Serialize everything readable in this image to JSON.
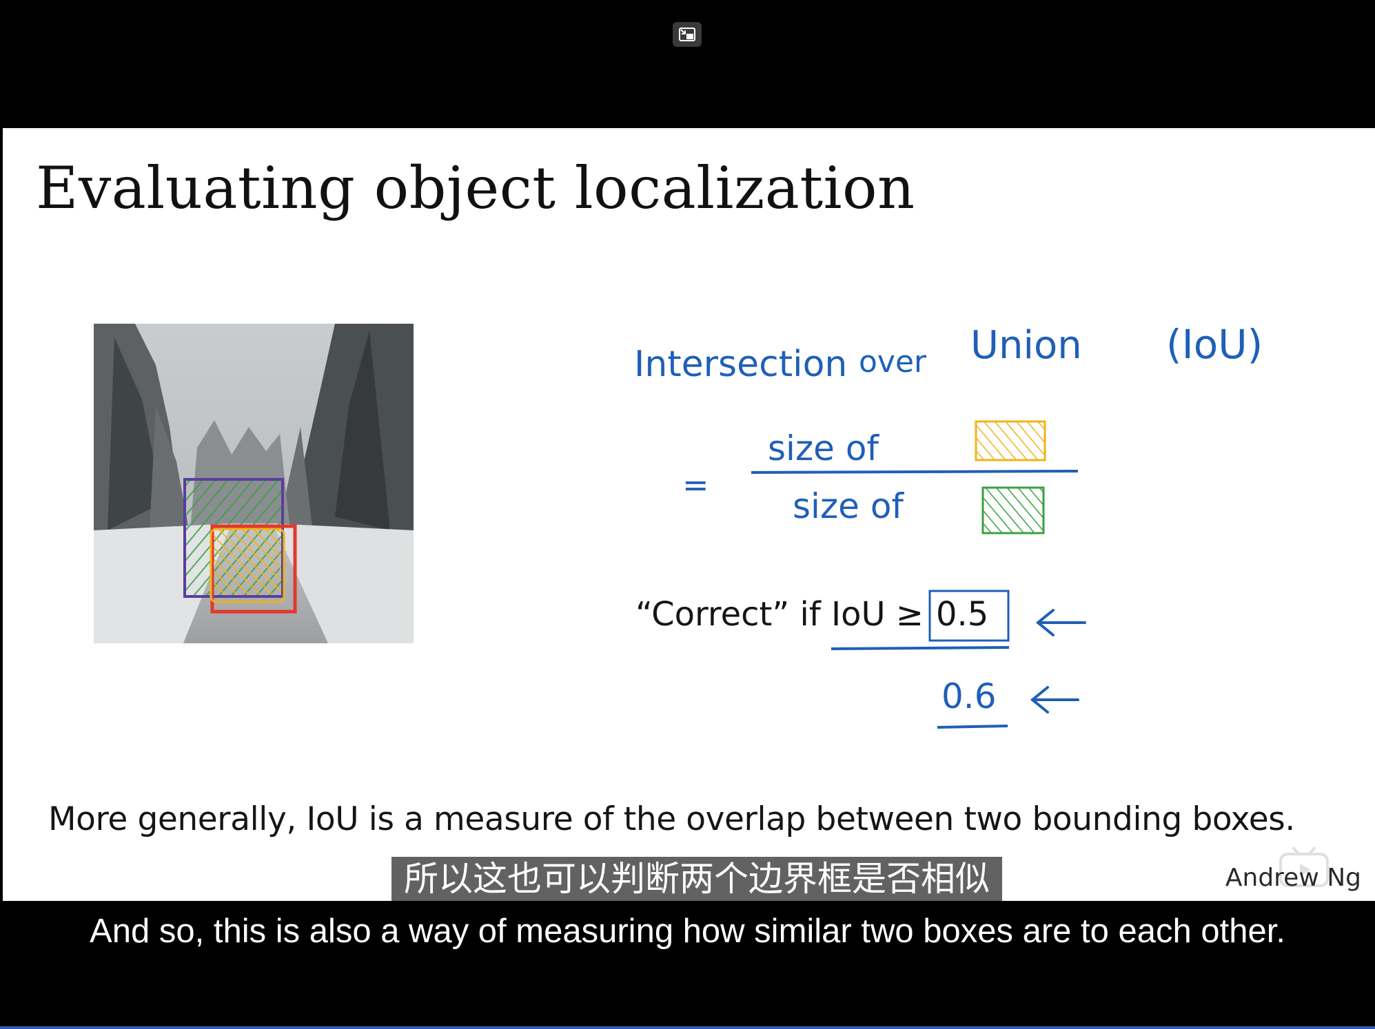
{
  "player": {
    "exit_pip_icon": "exit-picture-in-picture-icon"
  },
  "slide": {
    "title": "Evaluating object localization",
    "photo_icon": "snowy-road-photo",
    "handwriting": {
      "line1_a": "Intersection",
      "line1_b": "over",
      "line1_c": "Union",
      "line1_d": "(IoU)",
      "equals": "=",
      "numerator": "size of",
      "denominator": "size of",
      "alt_threshold": "0.6",
      "arrow_icon": "left-arrow-icon"
    },
    "correct_prefix": "“Correct” if IoU ≥",
    "threshold": "0.5",
    "summary": "More generally, IoU is a measure of the overlap between two bounding boxes.",
    "author": "Andrew Ng",
    "colors": {
      "ink_blue": "#1f5fb8",
      "box_purple": "#5a3e9e",
      "box_red": "#e03a2a",
      "hatch_green": "#3aa040",
      "hatch_yellow": "#f2b21a"
    }
  },
  "subtitles": {
    "chinese": "所以这也可以判断两个边界框是否相似",
    "english": "And so, this is also a way of measuring how similar two boxes are to each other."
  }
}
